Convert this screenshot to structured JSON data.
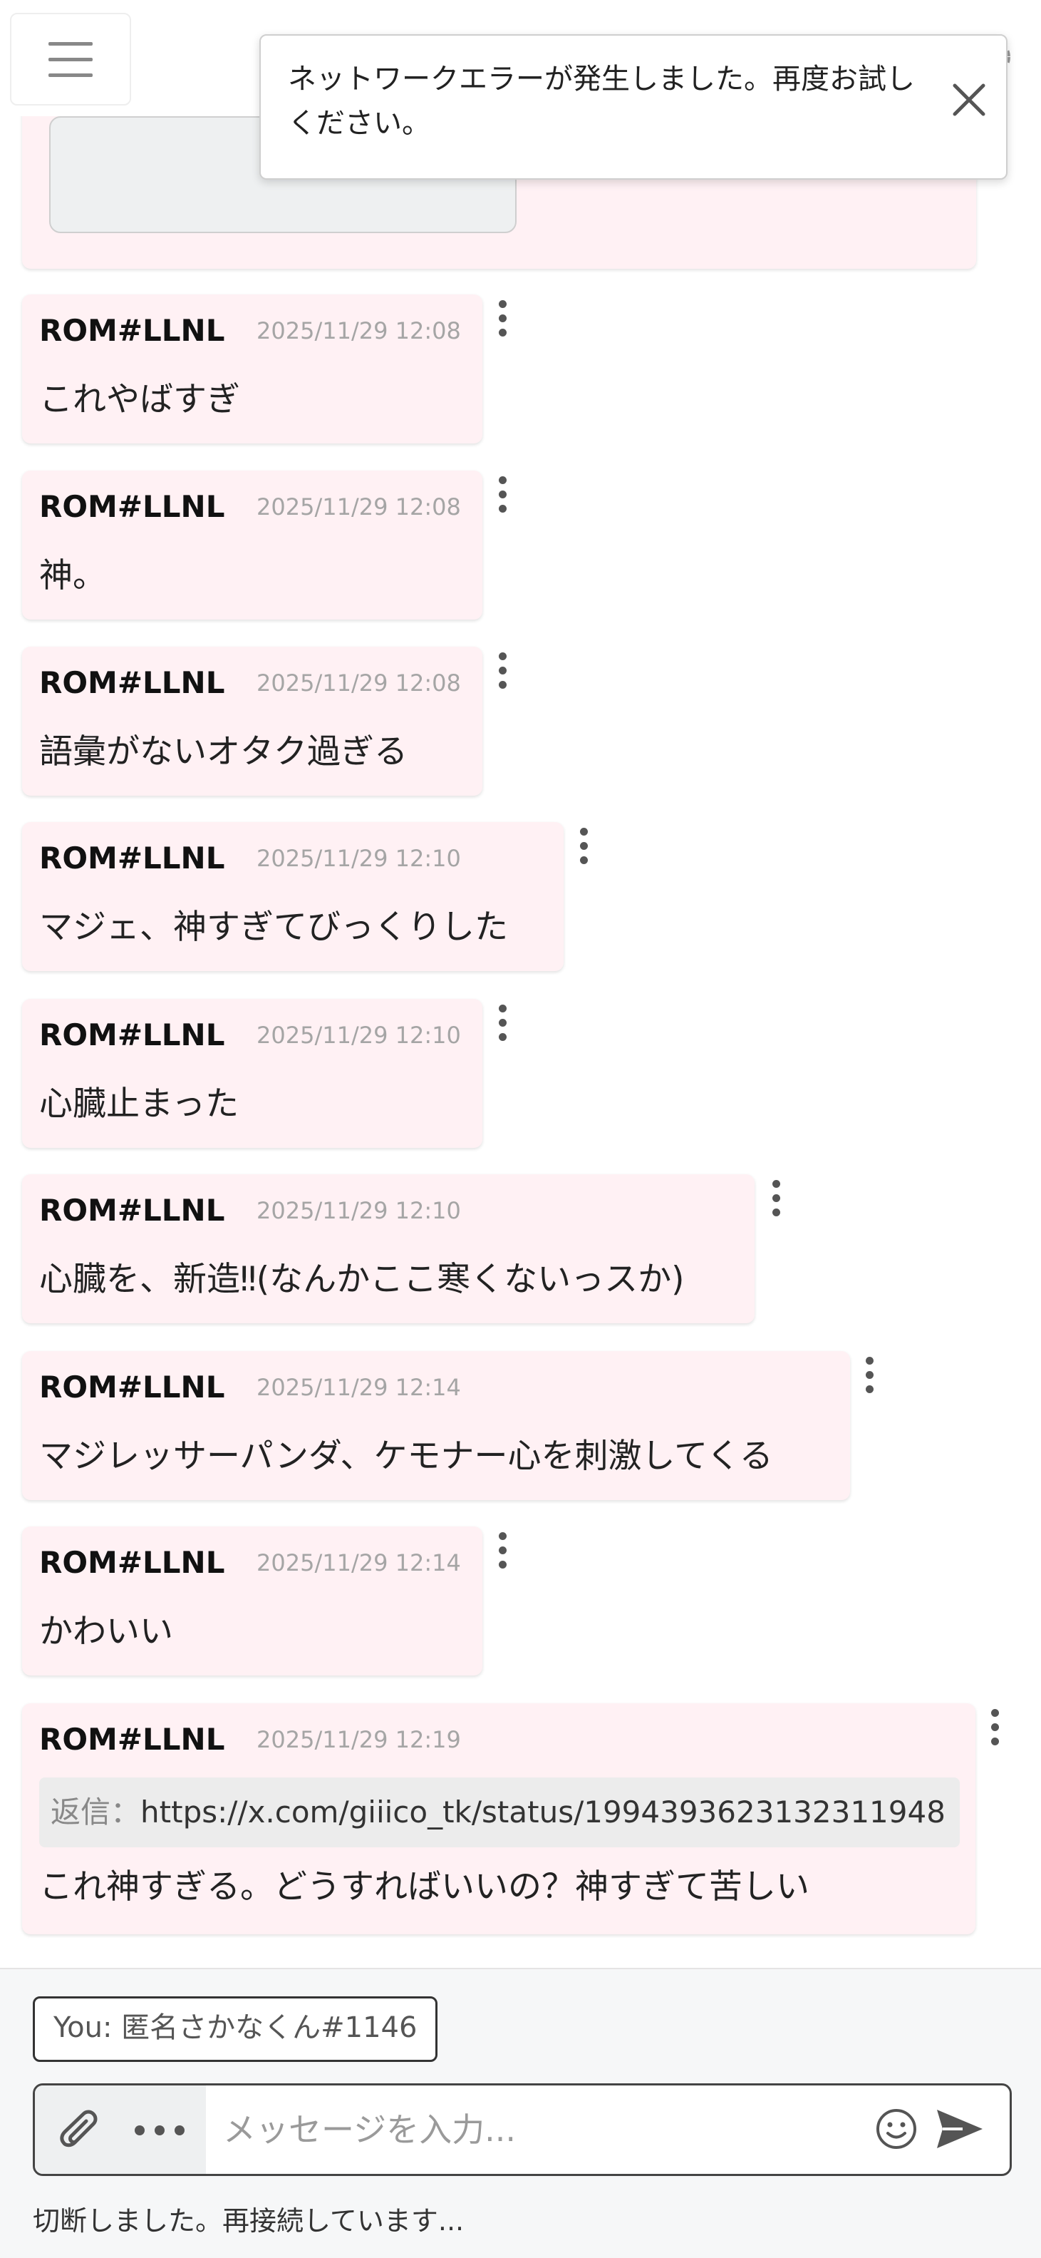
{
  "toast": {
    "message": "ネットワークエラーが発生しました。再度お試しください。"
  },
  "messages": [
    {
      "author": "ROM#LLNL",
      "time": "2025/11/29 12:08",
      "text": "これやばすぎ"
    },
    {
      "author": "ROM#LLNL",
      "time": "2025/11/29 12:08",
      "text": "神。"
    },
    {
      "author": "ROM#LLNL",
      "time": "2025/11/29 12:08",
      "text": "語彙がないオタク過ぎる"
    },
    {
      "author": "ROM#LLNL",
      "time": "2025/11/29 12:10",
      "text": "マジェ、神すぎてびっくりした"
    },
    {
      "author": "ROM#LLNL",
      "time": "2025/11/29 12:10",
      "text": "心臓止まった"
    },
    {
      "author": "ROM#LLNL",
      "time": "2025/11/29 12:10",
      "text": "心臓を、新造‼(なんかここ寒くないっスか)"
    },
    {
      "author": "ROM#LLNL",
      "time": "2025/11/29 12:14",
      "text": "マジレッサーパンダ、ケモナー心を刺激してくる"
    },
    {
      "author": "ROM#LLNL",
      "time": "2025/11/29 12:14",
      "text": "かわいい"
    },
    {
      "author": "ROM#LLNL",
      "time": "2025/11/29 12:19",
      "text": "これ神すぎる。どうすればいいの？神すぎて苦しい",
      "reply": {
        "label": "返信：",
        "url": "https://x.com/giiico_tk/status/1994393623132311948"
      }
    }
  ],
  "composer": {
    "you_label": "You: 匿名さかなくん#1146",
    "placeholder": "メッセージを入力..."
  },
  "status": "切断しました。再接続しています..."
}
